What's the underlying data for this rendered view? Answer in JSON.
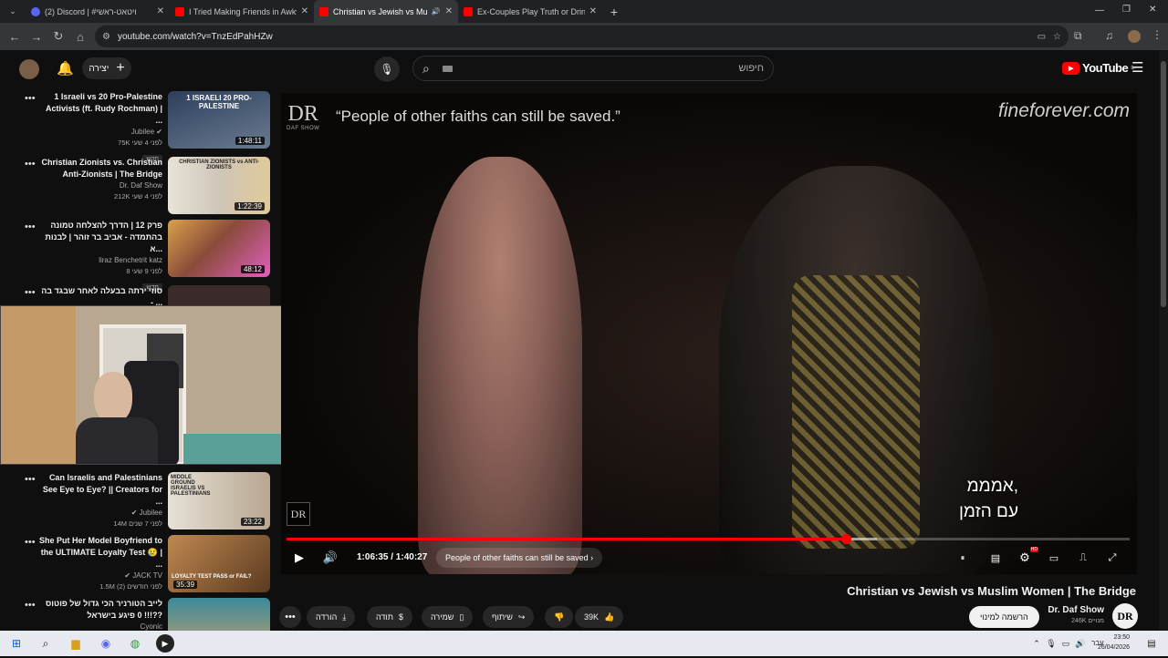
{
  "browser": {
    "tabs": [
      {
        "label": "(2) Discord | #ויטאט-ראשי",
        "favicon_color": "#5865f2"
      },
      {
        "label": "I Tried Making Friends in Awkw",
        "favicon_color": "#ff0000"
      },
      {
        "label": "Christian vs Jewish vs Musl",
        "favicon_color": "#ff0000",
        "active": true
      },
      {
        "label": "Ex-Couples Play Truth or Drink",
        "favicon_color": "#ff0000"
      }
    ],
    "url": "youtube.com/watch?v=TnzEdPahHZw"
  },
  "header": {
    "create_label": "יצירה",
    "search_placeholder": "חיפוש",
    "logo_text": "YouTube",
    "logo_country": "IL"
  },
  "recommendations": [
    {
      "title": "1 Israeli vs 20 Pro-Palestine Activists (ft. Rudy Rochman) | ...",
      "channel": "Jubilee",
      "verified": true,
      "stats": "75K  לפני 4 שעי",
      "badge": "חדש",
      "duration": "1:48:11",
      "thumb_text": "1 ISRAELI 20 PRO-PALESTINE",
      "thumb_color": "#3a4b66"
    },
    {
      "title": "Christian Zionists vs. Christian Anti-Zionists | The Bridge",
      "channel": "Dr. Daf Show",
      "verified": false,
      "stats": "212K  לפני 4 שעי",
      "badge": "",
      "duration": "1:22:39",
      "thumb_text": "CHRISTIAN ZIONISTS vs ANTI-ZIONISTS",
      "thumb_color": "#d9d3c8"
    },
    {
      "title": "פרק 12 | הדרך להצלחה טמונה בהתמדה - אביב בר זוהר | לבנות א...",
      "channel": "liraz Benchetrit katz",
      "verified": false,
      "stats": "8  לפני 9 שעי",
      "badge": "חדש",
      "duration": "48:12",
      "thumb_text": "",
      "thumb_color": "#7a3a2e"
    },
    {
      "title": "סוזי ירתה בבעלה לאחר שבגד בה - ...",
      "channel": "",
      "verified": false,
      "stats": "",
      "badge": "",
      "duration": "",
      "thumb_text": "",
      "thumb_color": "#3a2a2a"
    },
    {
      "title": "Can Israelis and Palestinians See Eye to Eye? || Creators for ...",
      "channel": "Jubilee",
      "verified": true,
      "stats": "14M  לפני 7 שנים",
      "badge": "",
      "duration": "23:22",
      "thumb_text": "MIDDLE GROUND ISRAELIS VS PALESTINIANS",
      "thumb_color": "#d7d2c8"
    },
    {
      "title": "She Put Her Model Boyfriend to the ULTIMATE Loyalty Test 😢 | ...",
      "channel": "JACK TV",
      "verified": true,
      "stats": "1.5M  (2) לפני חודשים",
      "badge": "",
      "duration": "35:39",
      "thumb_text": "LOYALTY TEST PASS or FAIL?",
      "thumb_color": "#8a5a2e"
    },
    {
      "title": "לייב הטורניר הכי גדול של פוטוס !!! 0 פיגע בישראל??",
      "channel": "Cyonic",
      "verified": true,
      "stats": "",
      "badge": "",
      "duration": "",
      "thumb_text": "",
      "thumb_color": "#2e6a7a"
    }
  ],
  "player": {
    "brand_mark": "DR",
    "brand_sub": "DAF SHOW",
    "quote": "“People of other faiths can still be saved.”",
    "site": "fineforever.com",
    "caption_line1": "אמממ,",
    "caption_line2": "עם הזמן",
    "current_time": "1:06:35",
    "duration": "1:40:27",
    "time_display": "1:06:35 / 1:40:27",
    "chapter": "People of other faiths can still be saved",
    "progress_played": 0.663,
    "progress_buffered": 0.7,
    "settings_badge": "HD"
  },
  "video": {
    "title": "Christian vs Jewish vs Muslim Women | The Bridge",
    "channel": "Dr. Daf Show",
    "subscribers": "246K מנויים",
    "subscribe_label": "הרשמה למינוי",
    "like_count": "39K",
    "share_label": "שיתוף",
    "save_label": "שמירה",
    "thanks_label": "תודה",
    "download_label": "הורדה"
  },
  "taskbar": {
    "time": "23:50",
    "date": "26/04/2026",
    "lang": "עבר"
  }
}
